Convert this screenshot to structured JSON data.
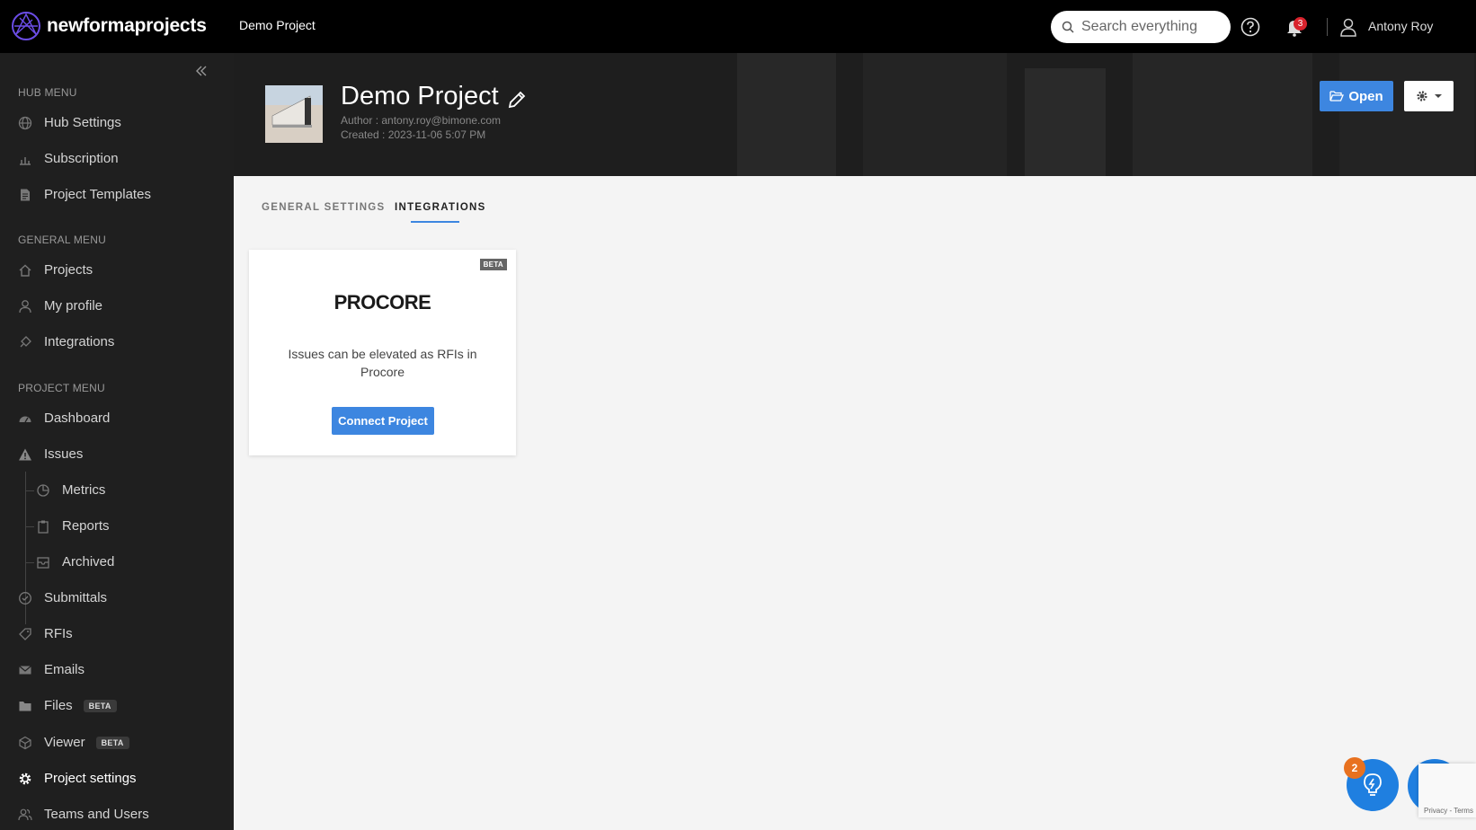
{
  "topbar": {
    "brand": "newformaprojects",
    "project_name": "Demo Project",
    "search_placeholder": "Search everything",
    "notification_count": "3",
    "user_name": "Antony Roy"
  },
  "sidebar": {
    "hub_menu": {
      "title": "HUB MENU",
      "items": [
        "Hub Settings",
        "Subscription",
        "Project Templates"
      ]
    },
    "general_menu": {
      "title": "GENERAL MENU",
      "items": [
        "Projects",
        "My profile",
        "Integrations"
      ]
    },
    "project_menu": {
      "title": "PROJECT MENU",
      "items": [
        "Dashboard",
        "Issues",
        "Metrics",
        "Reports",
        "Archived",
        "Submittals",
        "RFIs",
        "Emails",
        "Files",
        "Viewer",
        "Project settings",
        "Teams and Users"
      ],
      "beta_label": "BETA"
    }
  },
  "hero": {
    "title": "Demo Project",
    "author": "Author : antony.roy@bimone.com",
    "created": "Created : 2023-11-06 5:07 PM",
    "open_label": "Open"
  },
  "tabs": {
    "general": "GENERAL SETTINGS",
    "integrations": "INTEGRATIONS"
  },
  "card": {
    "beta": "BETA",
    "logo_text": "PROCORE",
    "description": "Issues can be elevated as RFIs in Procore",
    "button": "Connect Project"
  },
  "floating": {
    "bulb_badge": "2",
    "recaptcha": "Privacy - Terms"
  },
  "colors": {
    "accent": "#3d86e0",
    "sidebar_bg": "#1f1f1f",
    "topbar_bg": "#000000",
    "badge_red": "#d9232d",
    "badge_orange": "#e8711f"
  }
}
